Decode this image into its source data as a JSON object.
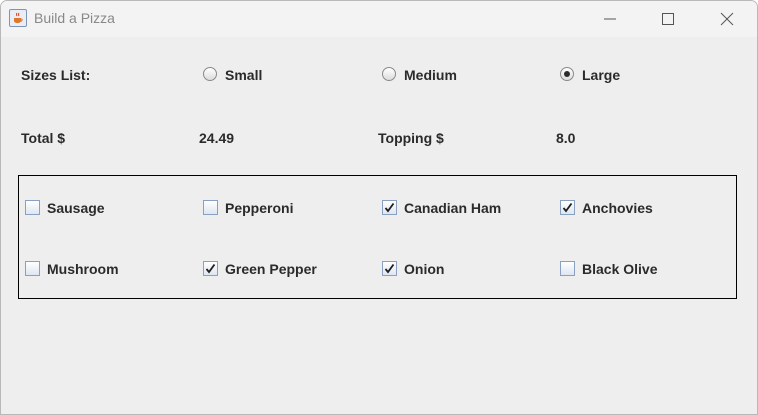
{
  "window": {
    "title": "Build a Pizza"
  },
  "sizes": {
    "label": "Sizes List:",
    "options": [
      {
        "label": "Small",
        "selected": false
      },
      {
        "label": "Medium",
        "selected": false
      },
      {
        "label": "Large",
        "selected": true
      }
    ]
  },
  "totals": {
    "total_label": "Total $",
    "total_value": "24.49",
    "topping_label": "Topping $",
    "topping_value": "8.0"
  },
  "toppings": [
    {
      "label": "Sausage",
      "checked": false
    },
    {
      "label": "Pepperoni",
      "checked": false
    },
    {
      "label": "Canadian Ham",
      "checked": true
    },
    {
      "label": "Anchovies",
      "checked": true
    },
    {
      "label": "Mushroom",
      "checked": false
    },
    {
      "label": "Green Pepper",
      "checked": true
    },
    {
      "label": "Onion",
      "checked": true
    },
    {
      "label": "Black Olive",
      "checked": false
    }
  ],
  "icons": {
    "app": "java-cup-icon",
    "minimize": "minimize-icon",
    "maximize": "maximize-icon",
    "close": "close-icon"
  }
}
